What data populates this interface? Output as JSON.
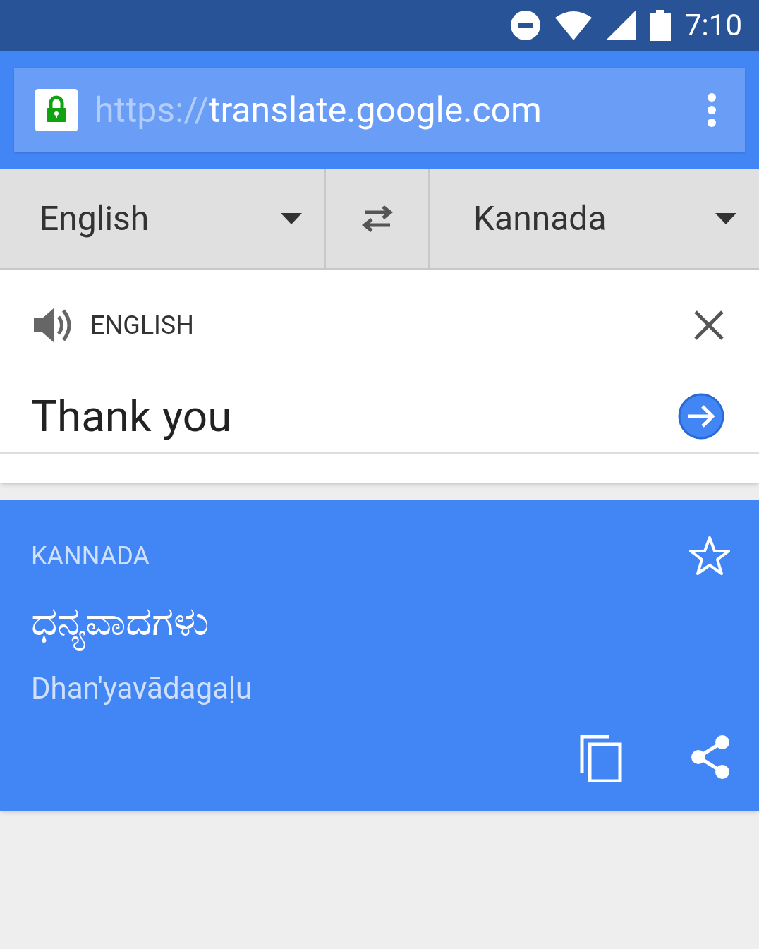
{
  "status_bar": {
    "time": "7:10"
  },
  "address_bar": {
    "secure": true,
    "scheme": "https://",
    "host": "translate.google.com"
  },
  "language_bar": {
    "source": "English",
    "target": "Kannada"
  },
  "input_card": {
    "language": "ENGLISH",
    "text": "Thank you"
  },
  "result_card": {
    "language": "KANNADA",
    "translation": "ಧನ್ಯವಾದಗಳು",
    "transliteration": "Dhan'yavādagaḷu",
    "starred": false
  }
}
